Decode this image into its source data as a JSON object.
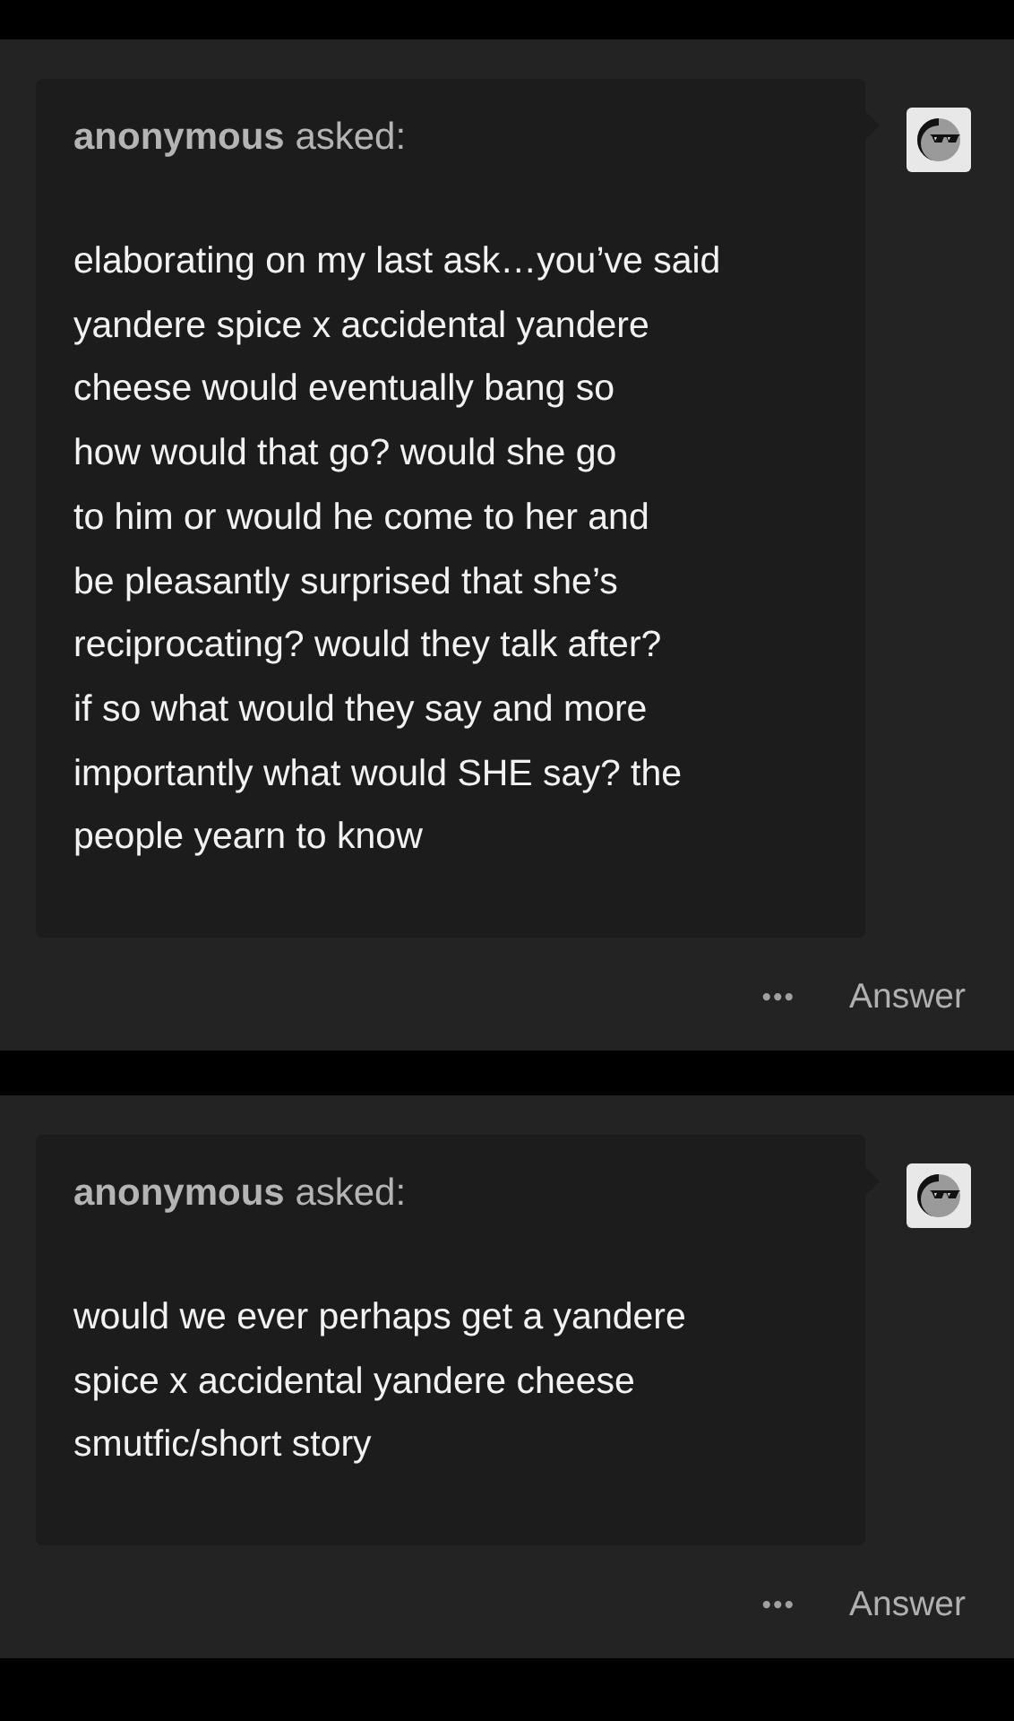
{
  "posts": [
    {
      "asker": "anonymous",
      "verb": "asked:",
      "question_lines": [
        "elaborating on my last ask…you’ve said",
        "yandere spice x accidental yandere",
        "cheese would eventually bang so",
        "how would that go? would she go",
        "to him or would he come to her and",
        "be pleasantly surprised that she’s",
        "reciprocating? would they talk after?",
        "if so what would they say and more",
        "importantly what would SHE say? the",
        "people yearn to know"
      ],
      "more": "•••",
      "answer": "Answer"
    },
    {
      "asker": "anonymous",
      "verb": "asked:",
      "question_lines": [
        "would we ever perhaps get a yandere",
        "spice x accidental yandere cheese",
        "smutfic/short story"
      ],
      "more": "•••",
      "answer": "Answer"
    }
  ]
}
